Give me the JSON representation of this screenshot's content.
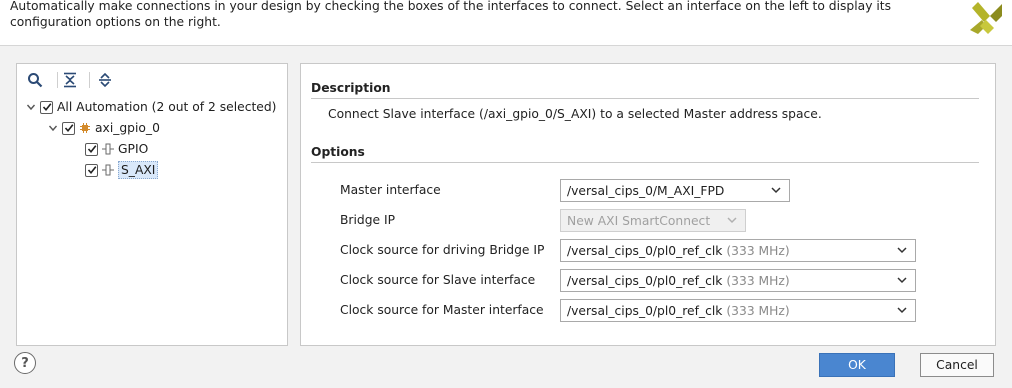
{
  "header": {
    "text": "Automatically make connections in your design by checking the boxes of the interfaces to connect. Select an interface on the left to display its configuration options on the right."
  },
  "toolbar": {
    "icons": [
      "search-icon",
      "collapse-all-icon",
      "expand-all-icon"
    ]
  },
  "tree": {
    "root": {
      "label": "All Automation (2 out of 2 selected)",
      "checked": true,
      "expanded": true
    },
    "ip": {
      "label": "axi_gpio_0",
      "checked": true,
      "expanded": true
    },
    "interfaces": [
      {
        "label": "GPIO",
        "checked": true,
        "selected": false
      },
      {
        "label": "S_AXI",
        "checked": true,
        "selected": true
      }
    ]
  },
  "description": {
    "title": "Description",
    "text": "Connect Slave interface (/axi_gpio_0/S_AXI) to a selected Master address space."
  },
  "options": {
    "title": "Options",
    "rows": [
      {
        "label": "Master interface",
        "value": "/versal_cips_0/M_AXI_FPD",
        "freq": "",
        "enabled": true
      },
      {
        "label": "Bridge IP",
        "value": "New AXI SmartConnect",
        "freq": "",
        "enabled": false
      },
      {
        "label": "Clock source for driving Bridge IP",
        "value": "/versal_cips_0/pl0_ref_clk",
        "freq": "(333 MHz)",
        "enabled": true
      },
      {
        "label": "Clock source for Slave interface",
        "value": "/versal_cips_0/pl0_ref_clk",
        "freq": "(333 MHz)",
        "enabled": true
      },
      {
        "label": "Clock source for Master interface",
        "value": "/versal_cips_0/pl0_ref_clk",
        "freq": "(333 MHz)",
        "enabled": true
      }
    ]
  },
  "buttons": {
    "help": "?",
    "ok": "OK",
    "cancel": "Cancel"
  },
  "colors": {
    "accent": "#4a86d0",
    "selection": "#d9e8fa",
    "ip_icon": "#d38b2c"
  }
}
